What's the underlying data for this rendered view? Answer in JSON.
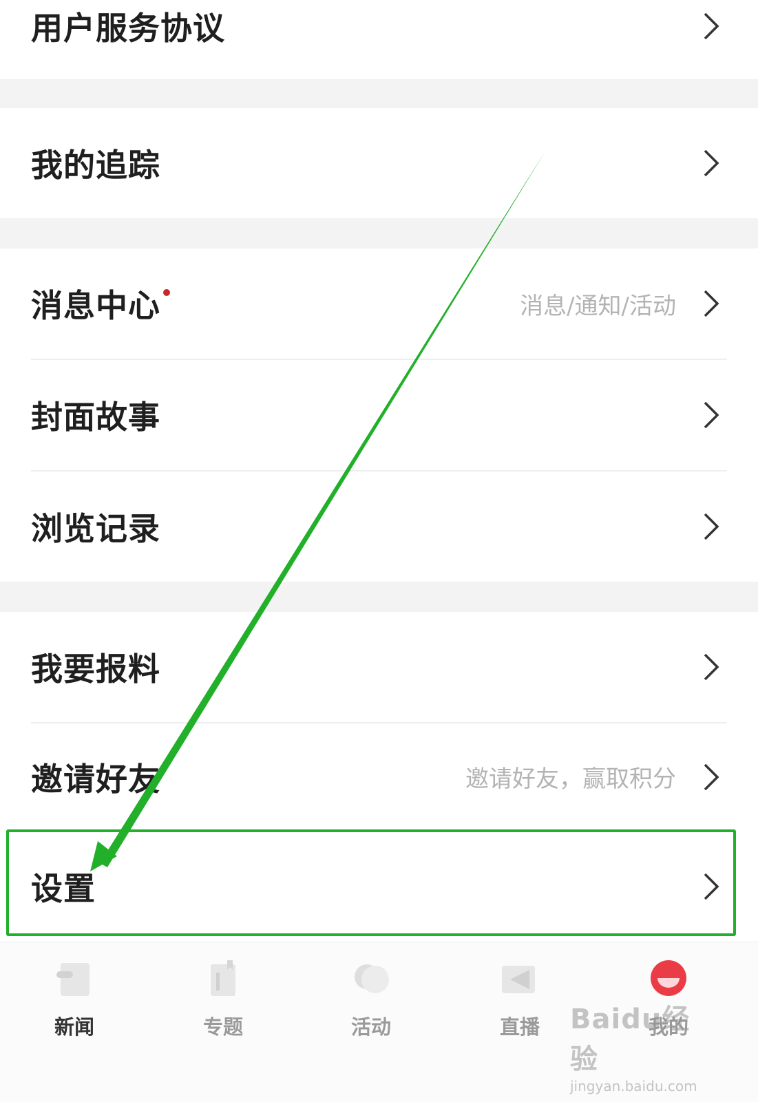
{
  "menu": {
    "items": [
      {
        "label": "用户服务协议",
        "hint": ""
      },
      {
        "label": "我的追踪",
        "hint": ""
      },
      {
        "label": "消息中心",
        "hint": "消息/通知/活动"
      },
      {
        "label": "封面故事",
        "hint": ""
      },
      {
        "label": "浏览记录",
        "hint": ""
      },
      {
        "label": "我要报料",
        "hint": ""
      },
      {
        "label": "邀请好友",
        "hint": "邀请好友，赢取积分"
      },
      {
        "label": "设置",
        "hint": ""
      }
    ]
  },
  "tabbar": {
    "tabs": [
      {
        "label": "新闻"
      },
      {
        "label": "专题"
      },
      {
        "label": "活动"
      },
      {
        "label": "直播"
      },
      {
        "label": "我的"
      }
    ],
    "active_index": 0
  },
  "watermark": {
    "line1": "Baidu经验",
    "line2": "jingyan.baidu.com"
  },
  "colors": {
    "annotation": "#22b02a",
    "badge": "#c82727",
    "profile_accent": "#ea3c46"
  }
}
